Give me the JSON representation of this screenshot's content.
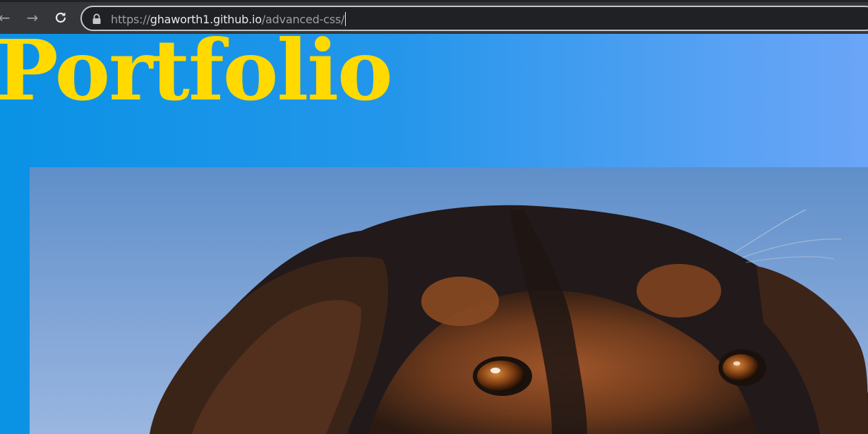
{
  "browser": {
    "url_scheme": "https://",
    "url_host": "ghaworth1.github.io",
    "url_path": "/advanced-css/",
    "icons": {
      "back": "arrow-left-icon",
      "forward": "arrow-right-icon",
      "reload": "reload-icon",
      "lock": "lock-icon"
    }
  },
  "page": {
    "title": "Portfolio",
    "photo_alt": "dog",
    "colors": {
      "background": "#0a92e5",
      "title": "#ffd900"
    }
  }
}
